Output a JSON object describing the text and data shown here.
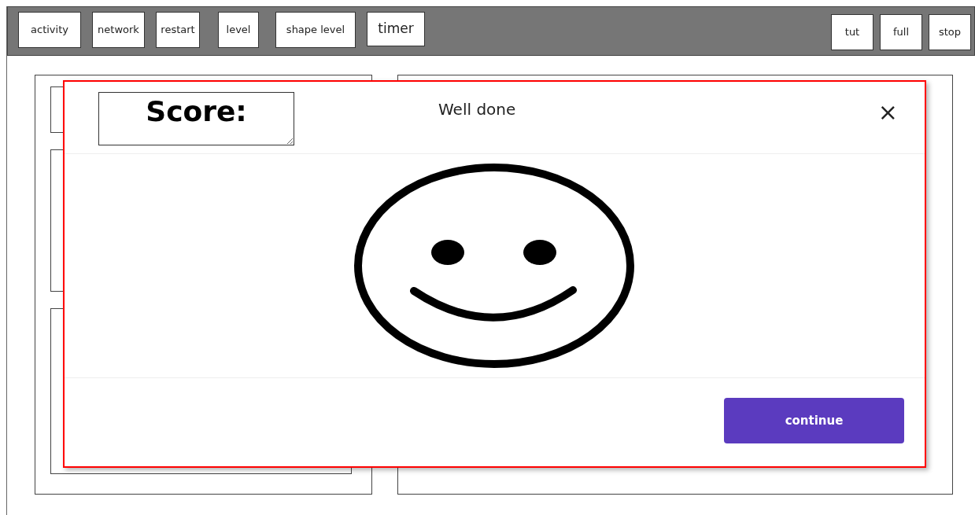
{
  "toolbar": {
    "left_buttons": [
      {
        "label": "activity",
        "kind": "button"
      },
      {
        "label": "network",
        "kind": "button"
      },
      {
        "label": "restart",
        "kind": "button"
      },
      {
        "label": "level",
        "kind": "button"
      },
      {
        "label": "shape level",
        "kind": "button"
      },
      {
        "label": "timer",
        "kind": "timer"
      }
    ],
    "right_buttons": [
      "tut",
      "full",
      "stop"
    ]
  },
  "dialog": {
    "score_field": "Score:",
    "title": "Well done",
    "close": "×",
    "buttons": [
      "continue"
    ]
  }
}
